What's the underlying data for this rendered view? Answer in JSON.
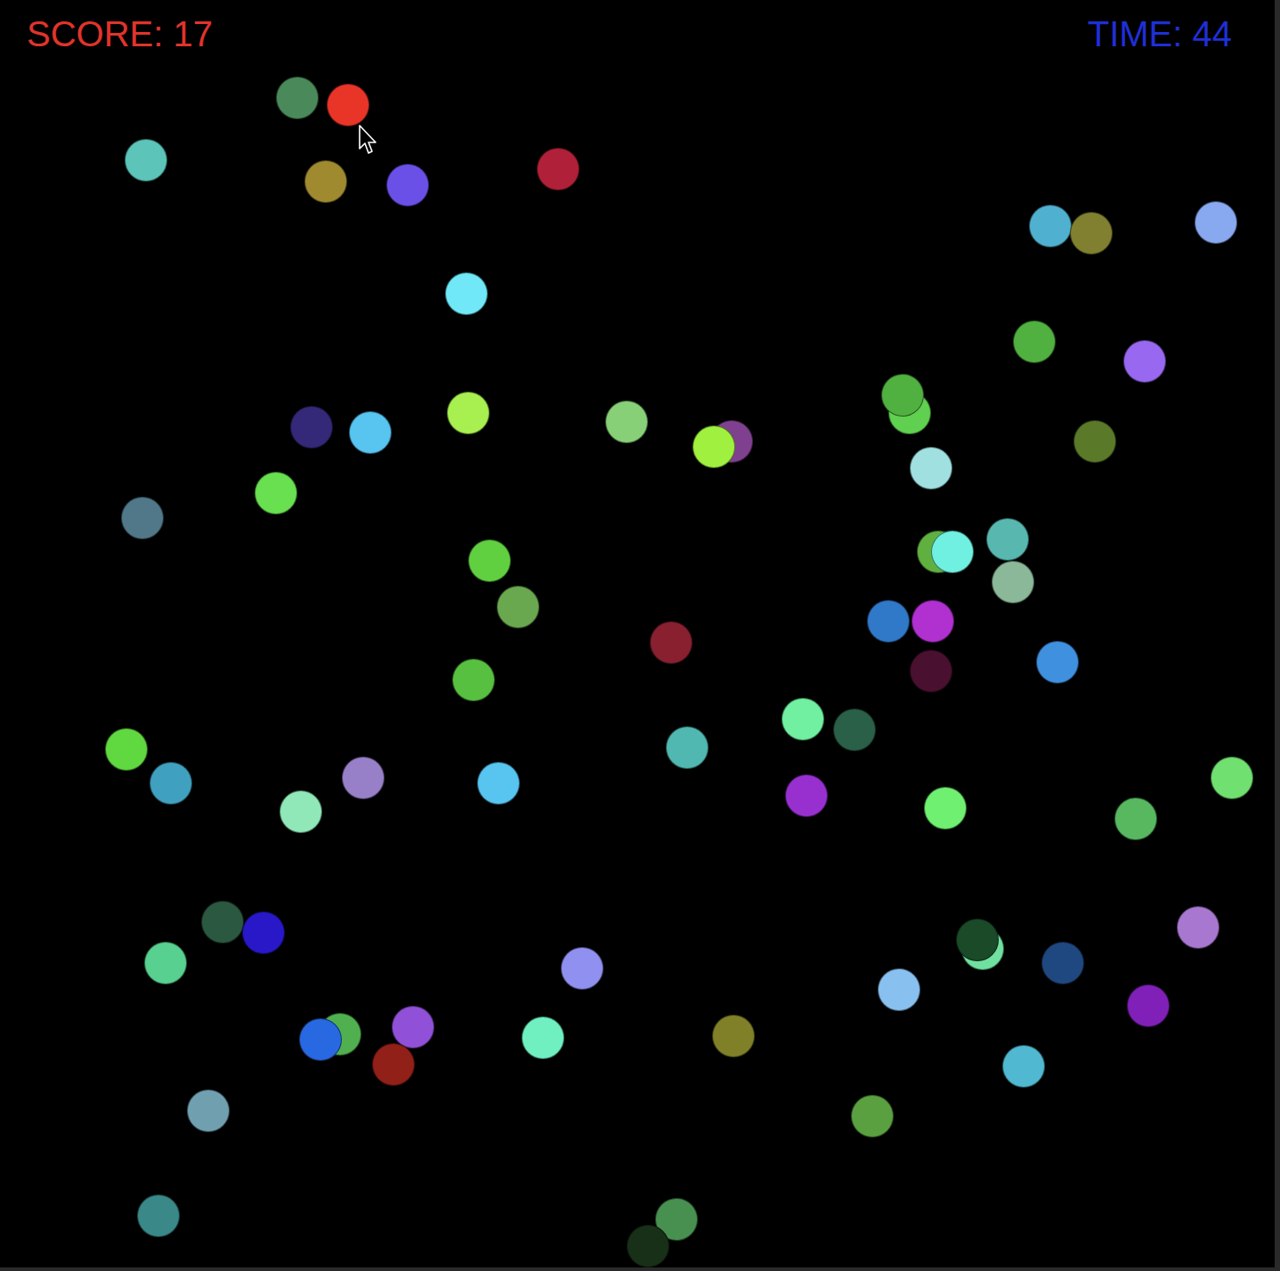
{
  "hud": {
    "score": "SCORE: 17",
    "time": "TIME: 44"
  },
  "balls": [
    {
      "color": "#4a8a5a"
    },
    {
      "color": "#e83528"
    },
    {
      "color": "#5cc4b8"
    },
    {
      "color": "#a08a30"
    },
    {
      "color": "#6b50e8"
    },
    {
      "color": "#b02038"
    },
    {
      "color": "#50b0d0"
    },
    {
      "color": "#808030"
    },
    {
      "color": "#88a8f0"
    },
    {
      "color": "#70e8f8"
    },
    {
      "color": "#50b040"
    },
    {
      "color": "#9868f0"
    },
    {
      "color": "#60d050"
    },
    {
      "color": "#50b040"
    },
    {
      "color": "#342878"
    },
    {
      "color": "#58c4f0"
    },
    {
      "color": "#a8f050"
    },
    {
      "color": "#88d078"
    },
    {
      "color": "#804090"
    },
    {
      "color": "#a0f040"
    },
    {
      "color": "#5a7a2a"
    },
    {
      "color": "#a0e0e0"
    },
    {
      "color": "#507888"
    },
    {
      "color": "#68e050"
    },
    {
      "color": "#60b040"
    },
    {
      "color": "#70f0e0"
    },
    {
      "color": "#58b8b0"
    },
    {
      "color": "#8ab898"
    },
    {
      "color": "#60d040"
    },
    {
      "color": "#6aa850"
    },
    {
      "color": "#3078c8"
    },
    {
      "color": "#b030d0"
    },
    {
      "color": "#882030"
    },
    {
      "color": "#4a1030"
    },
    {
      "color": "#4090e0"
    },
    {
      "color": "#58c040"
    },
    {
      "color": "#70f0a0"
    },
    {
      "color": "#2a6048"
    },
    {
      "color": "#50b8b0"
    },
    {
      "color": "#60d840"
    },
    {
      "color": "#40a0c0"
    },
    {
      "color": "#9880c8"
    },
    {
      "color": "#90e8b8"
    },
    {
      "color": "#58c4f0"
    },
    {
      "color": "#9830d0"
    },
    {
      "color": "#70f070"
    },
    {
      "color": "#58b860"
    },
    {
      "color": "#70e070"
    },
    {
      "color": "#2a5840"
    },
    {
      "color": "#2818c8"
    },
    {
      "color": "#58d090"
    },
    {
      "color": "#9090f0"
    },
    {
      "color": "#70e0a0"
    },
    {
      "color": "#1a4a28"
    },
    {
      "color": "#204880"
    },
    {
      "color": "#a878d0"
    },
    {
      "color": "#88c0f0"
    },
    {
      "color": "#8020b8"
    },
    {
      "color": "#50b050"
    },
    {
      "color": "#2868e0"
    },
    {
      "color": "#9050d8"
    },
    {
      "color": "#902018"
    },
    {
      "color": "#70f0c0"
    },
    {
      "color": "#808028"
    },
    {
      "color": "#50b8d0"
    },
    {
      "color": "#5aa040"
    },
    {
      "color": "#70a0b0"
    },
    {
      "color": "#3a8888"
    },
    {
      "color": "#489050"
    },
    {
      "color": "#183018"
    }
  ]
}
